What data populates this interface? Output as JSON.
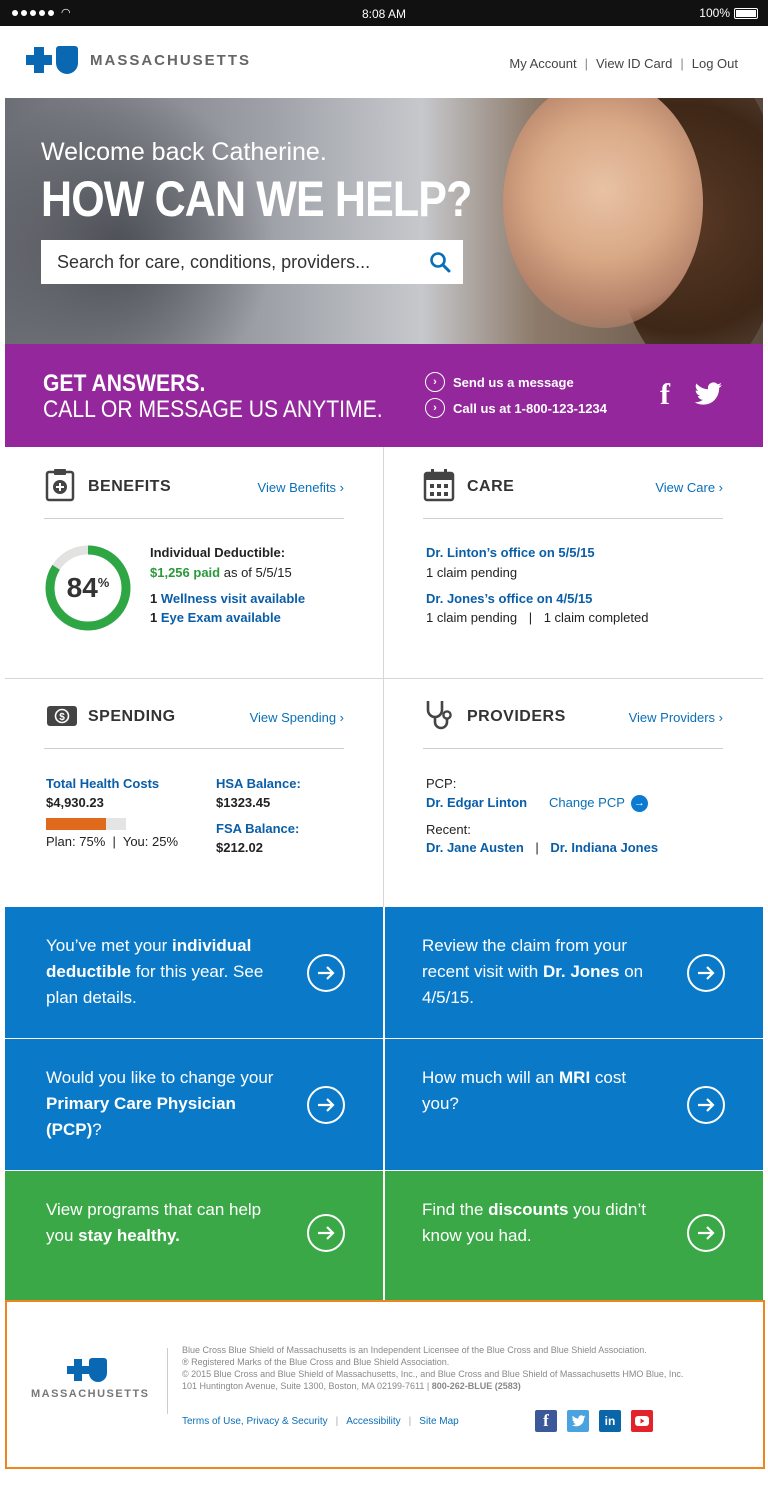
{
  "status_bar": {
    "time": "8:08 AM",
    "battery": "100%"
  },
  "header": {
    "brand": "MASSACHUSETTS",
    "nav": [
      "My Account",
      "View ID Card",
      "Log Out"
    ],
    "nav_sep": "|"
  },
  "hero": {
    "welcome": "Welcome back Catherine.",
    "headline": "HOW CAN WE HELP?",
    "search_placeholder": "Search for care, conditions, providers..."
  },
  "answers": {
    "line1": "GET ANSWERS.",
    "line2": "CALL OR MESSAGE US ANYTIME.",
    "message": "Send us a message",
    "call": "Call us at 1-800-123-1234"
  },
  "benefits": {
    "title": "BENEFITS",
    "link": "View Benefits ›",
    "percent": "84",
    "percent_sign": "%",
    "percent_value": 0.84,
    "deductible_label": "Individual Deductible:",
    "paid": "$1,256 paid",
    "paid_date": "as of 5/5/15",
    "wellness_count": "1",
    "wellness": "Wellness visit available",
    "eye_count": "1",
    "eye": "Eye Exam available"
  },
  "care": {
    "title": "CARE",
    "link": "View Care ›",
    "visit1": "Dr. Linton’s office on 5/5/15",
    "visit1_status": "1 claim pending",
    "visit2": "Dr. Jones’s office on 4/5/15",
    "visit2_pending": "1 claim pending",
    "visit2_sep": "|",
    "visit2_completed": "1 claim completed"
  },
  "spending": {
    "title": "SPENDING",
    "link": "View Spending ›",
    "total_label": "Total Health Costs",
    "total_value": "$4,930.23",
    "plan_share": 0.75,
    "split": "Plan: 75%  |  You: 25%",
    "hsa_label": "HSA Balance:",
    "hsa_value": "$1323.45",
    "fsa_label": "FSA Balance:",
    "fsa_value": "$212.02"
  },
  "providers": {
    "title": "PROVIDERS",
    "link": "View Providers ›",
    "pcp_label": "PCP:",
    "pcp_name": "Dr. Edgar Linton",
    "change_pcp": "Change PCP",
    "recent_label": "Recent:",
    "recent1": "Dr. Jane Austen",
    "recent_sep": "|",
    "recent2": "Dr. Indiana Jones"
  },
  "tiles": {
    "t1": {
      "a": "You’ve met your ",
      "b": "individual deductible",
      "c": " for this year. See plan details."
    },
    "t2": {
      "a": "Review the claim from your recent visit with ",
      "b": "Dr. Jones",
      "c": " on 4/5/15."
    },
    "t3": {
      "a": "Would you like to change your ",
      "b": "Primary Care Physician (PCP)",
      "c": "?"
    },
    "t4": {
      "a": "How much will an ",
      "b": "MRI",
      "c": " cost you?"
    },
    "t5": {
      "a": "View programs that can help you ",
      "b": "stay healthy.",
      "c": ""
    },
    "t6": {
      "a": "Find the ",
      "b": "discounts",
      "c": " you didn’t know you had."
    }
  },
  "footer": {
    "brand": "MASSACHUSETTS",
    "legal1": "Blue Cross Blue Shield of Massachusetts is an Independent Licensee of the Blue Cross and Blue Shield Association.",
    "legal2": "® Registered Marks of the Blue Cross and Blue Shield Association.",
    "legal3": "© 2015 Blue Cross and Blue Shield of Massachusetts, Inc., and Blue Cross and Blue Shield of Massachusetts HMO Blue, Inc.",
    "legal4a": "101 Huntington Avenue, Suite 1300, Boston, MA 02199-7611 | ",
    "legal4b": "800-262-BLUE (2583)",
    "links": [
      "Terms of Use, Privacy & Security",
      "Accessibility",
      "Site Map"
    ],
    "link_sep": "|"
  },
  "colors": {
    "brand_blue": "#0a68b3",
    "purple": "#93279b",
    "tile_blue": "#0a7ac8",
    "tile_green": "#3aa846",
    "ring_green": "#2ea643",
    "bar_orange": "#e06a1c",
    "footer_outline": "#f0851e"
  }
}
